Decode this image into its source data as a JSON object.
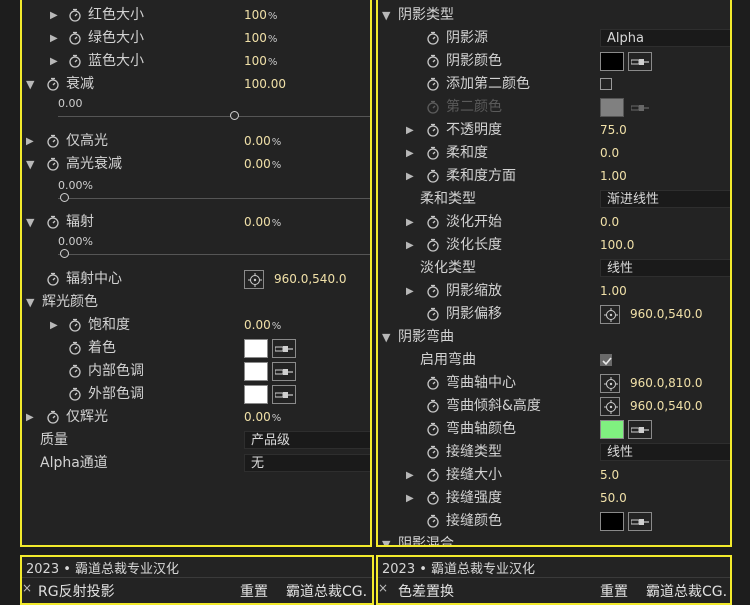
{
  "left": {
    "rows": [
      {
        "label": "红色大小",
        "value": "100",
        "unit": "%"
      },
      {
        "label": "绿色大小",
        "value": "100",
        "unit": "%"
      },
      {
        "label": "蓝色大小",
        "value": "100",
        "unit": "%"
      },
      {
        "label": "衰减",
        "value": "100.00",
        "slider_label": "0.00",
        "slider_position": 0.78
      },
      {
        "label": "仅高光",
        "value": "0.00",
        "unit": "%"
      },
      {
        "label": "高光衰减",
        "value": "0.00",
        "unit": "%",
        "slider_label": "0.00%",
        "slider_position": 0.0
      },
      {
        "label": "辐射",
        "value": "0.00",
        "unit": "%",
        "slider_label": "0.00%",
        "slider_position": 0.0
      },
      {
        "label": "辐射中心",
        "value": "960.0,540.0"
      },
      {
        "label": "辉光颜色"
      },
      {
        "label": "饱和度",
        "value": "0.00",
        "unit": "%"
      },
      {
        "label": "着色",
        "color": "#ffffff"
      },
      {
        "label": "内部色调",
        "color": "#ffffff"
      },
      {
        "label": "外部色调",
        "color": "#ffffff"
      },
      {
        "label": "仅辉光",
        "value": "0.00",
        "unit": "%"
      },
      {
        "label": "质量",
        "dropdown": "产品级"
      },
      {
        "label": "Alpha通道",
        "dropdown": "无"
      }
    ]
  },
  "right": {
    "rows": [
      {
        "label": "阴影类型"
      },
      {
        "label": "阴影源",
        "dropdown": "Alpha"
      },
      {
        "label": "阴影颜色",
        "color": "#000000"
      },
      {
        "label": "添加第二颜色",
        "checked": false
      },
      {
        "label": "第二颜色",
        "color": "#808080",
        "disabled": true
      },
      {
        "label": "不透明度",
        "value": "75.0"
      },
      {
        "label": "柔和度",
        "value": "0.0"
      },
      {
        "label": "柔和度方面",
        "value": "1.00"
      },
      {
        "label": "柔和类型",
        "dropdown": "渐进线性"
      },
      {
        "label": "淡化开始",
        "value": "0.0"
      },
      {
        "label": "淡化长度",
        "value": "100.0"
      },
      {
        "label": "淡化类型",
        "dropdown": "线性"
      },
      {
        "label": "阴影缩放",
        "value": "1.00"
      },
      {
        "label": "阴影偏移",
        "value": "960.0,540.0"
      },
      {
        "label": "阴影弯曲"
      },
      {
        "label": "启用弯曲",
        "checked": true
      },
      {
        "label": "弯曲轴中心",
        "value": "960.0,810.0"
      },
      {
        "label": "弯曲倾斜&高度",
        "value": "960.0,540.0"
      },
      {
        "label": "弯曲轴颜色",
        "color": "#80f080"
      },
      {
        "label": "接缝类型",
        "dropdown": "线性"
      },
      {
        "label": "接缝大小",
        "value": "5.0"
      },
      {
        "label": "接缝强度",
        "value": "50.0"
      },
      {
        "label": "接缝颜色",
        "color": "#000000"
      },
      {
        "label": "阴影混合"
      }
    ]
  },
  "bottom_left": {
    "title": "2023 • 霸道总裁专业汉化",
    "close": "×",
    "effect": "RG反射投影",
    "reset": "重置",
    "brand": "霸道总裁CG."
  },
  "bottom_right": {
    "title": "2023 • 霸道总裁专业汉化",
    "close": "×",
    "effect": "色差置换",
    "reset": "重置",
    "brand": "霸道总裁CG."
  }
}
